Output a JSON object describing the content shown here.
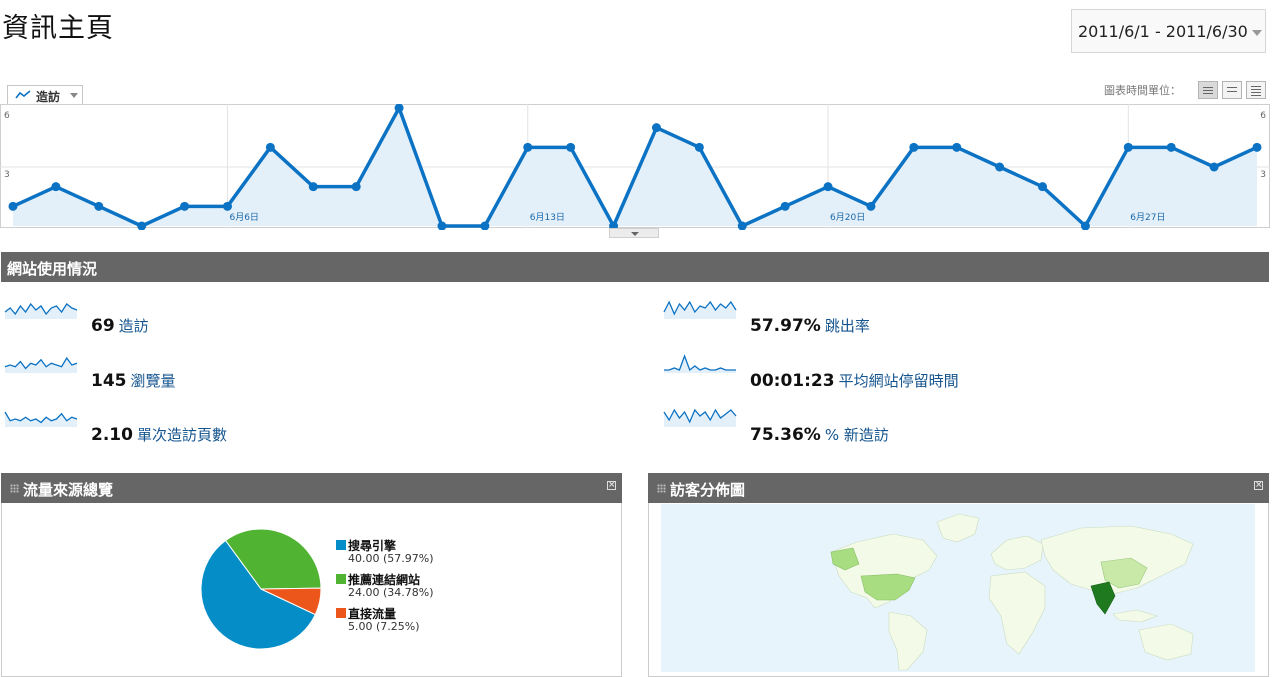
{
  "page": {
    "title": "資訊主頁"
  },
  "date_range": {
    "label": "2011/6/1 - 2011/6/30"
  },
  "chart": {
    "metric_selector": "造訪",
    "time_unit_label": "圖表時間單位："
  },
  "chart_data": {
    "type": "area",
    "series": [
      {
        "name": "造訪",
        "values": [
          1,
          2,
          1,
          0,
          1,
          1,
          4,
          2,
          2,
          6,
          0,
          0,
          4,
          4,
          0,
          5,
          4,
          0,
          1,
          2,
          1,
          4,
          4,
          3,
          2,
          0,
          4,
          4,
          3,
          4
        ]
      }
    ],
    "x": [
      "6/1",
      "6/2",
      "6/3",
      "6/4",
      "6/5",
      "6/6",
      "6/7",
      "6/8",
      "6/9",
      "6/10",
      "6/11",
      "6/12",
      "6/13",
      "6/14",
      "6/15",
      "6/16",
      "6/17",
      "6/18",
      "6/19",
      "6/20",
      "6/21",
      "6/22",
      "6/23",
      "6/24",
      "6/25",
      "6/26",
      "6/27",
      "6/28",
      "6/29",
      "6/30"
    ],
    "x_tick_labels": [
      "6月6日",
      "6月13日",
      "6月20日",
      "6月27日"
    ],
    "y_tick_labels_left": [
      "6",
      "3"
    ],
    "y_tick_labels_right": [
      "6",
      "3"
    ],
    "ylim": [
      0,
      6
    ],
    "color": "#0b72c4",
    "fill": "#e4f0f9"
  },
  "site_usage": {
    "title": "網站使用情況",
    "stats": [
      {
        "value": "69",
        "label": "造訪",
        "spark": [
          3,
          5,
          2,
          6,
          3,
          7,
          4,
          6,
          2,
          5,
          6,
          3,
          7,
          5,
          4
        ]
      },
      {
        "value": "145",
        "label": "瀏覽量",
        "spark": [
          3,
          4,
          3,
          6,
          2,
          5,
          4,
          7,
          3,
          5,
          4,
          3,
          8,
          4,
          5
        ]
      },
      {
        "value": "2.10",
        "label": "單次造訪頁數",
        "spark": [
          8,
          3,
          4,
          3,
          5,
          3,
          4,
          2,
          5,
          3,
          4,
          7,
          3,
          5,
          4
        ]
      },
      {
        "value": "57.97%",
        "label": "跳出率",
        "spark": [
          3,
          8,
          2,
          7,
          4,
          8,
          3,
          6,
          5,
          8,
          4,
          7,
          5,
          8,
          4
        ]
      },
      {
        "value": "00:01:23",
        "label": "平均網站停留時間",
        "spark": [
          1,
          1,
          2,
          1,
          8,
          1,
          3,
          1,
          2,
          1,
          1,
          2,
          1,
          1,
          1
        ]
      },
      {
        "value": "75.36%",
        "label": "% 新造訪",
        "spark": [
          7,
          3,
          8,
          4,
          7,
          2,
          8,
          5,
          7,
          3,
          8,
          4,
          6,
          8,
          5
        ]
      }
    ]
  },
  "traffic_sources": {
    "title": "流量來源總覽",
    "chart_data": {
      "type": "pie",
      "slices": [
        {
          "name": "搜尋引擎",
          "value": 40.0,
          "display": "40.00 (57.97%)",
          "color": "#058dc7"
        },
        {
          "name": "推薦連結網站",
          "value": 24.0,
          "display": "24.00 (34.78%)",
          "color": "#50b432"
        },
        {
          "name": "直接流量",
          "value": 5.0,
          "display": "5.00 (7.25%)",
          "color": "#ed561b"
        }
      ]
    }
  },
  "visitor_map": {
    "title": "訪客分佈圖"
  }
}
